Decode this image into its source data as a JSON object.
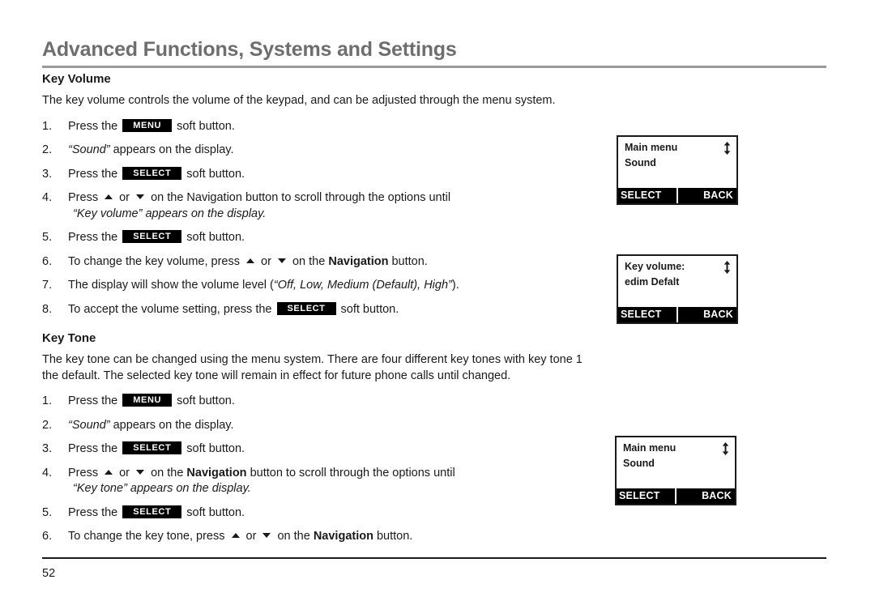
{
  "header": {
    "title": "Advanced Functions, Systems and Settings"
  },
  "sections": [
    {
      "title": "Key Volume",
      "intro": "The key volume controls the volume of the keypad, and can be adjusted through the menu system.",
      "steps": [
        {
          "num": "1.",
          "before": "Press the ",
          "chip": "MENU",
          "after": " soft button."
        },
        {
          "num": "2.",
          "quote": "“Sound”",
          "after": " appears on the display."
        },
        {
          "num": "3.",
          "before": "Press the ",
          "chip": "SELECT",
          "after": " soft button."
        },
        {
          "num": "4.",
          "before": "Press ",
          "arrows": true,
          "mid": " or ",
          "after": " on the Navigation button to scroll through the options until",
          "sub": "“Key volume” appears on the display."
        },
        {
          "num": "5.",
          "before": "Press the ",
          "chip": "SELECT",
          "after": " soft button."
        },
        {
          "num": "6.",
          "before": "To change the key volume, press ",
          "arrows": true,
          "mid": " or ",
          "after": " on the ",
          "bold": "Navigation",
          "tail": " button."
        },
        {
          "num": "7.",
          "before": "The display will show the volume level (",
          "italic": "“Off, Low, Medium (Default), High”",
          "after": ")."
        },
        {
          "num": "8.",
          "before": "To accept the volume setting, press the ",
          "chip": "SELECT",
          "after": " soft button."
        }
      ]
    },
    {
      "title": "Key Tone",
      "intro": "The key tone can be changed using the menu system. There are four different key tones with key tone 1 the default. The selected key tone will remain in effect for future phone calls until changed.",
      "steps": [
        {
          "num": "1.",
          "before": "Press the ",
          "chip": "MENU",
          "after": " soft button."
        },
        {
          "num": "2.",
          "quote": "“Sound”",
          "after": " appears on the display."
        },
        {
          "num": "3.",
          "before": "Press the ",
          "chip": "SELECT",
          "after": " soft button."
        },
        {
          "num": "4.",
          "before": "Press ",
          "arrows": true,
          "mid": " or ",
          "after": " on the ",
          "bold": "Navigation",
          "tail": " button to scroll through the options until",
          "sub": "“Key tone” appears on the display."
        },
        {
          "num": "5.",
          "before": "Press the ",
          "chip": "SELECT",
          "after": " soft button."
        },
        {
          "num": "6.",
          "before": "To change the key tone, press ",
          "arrows": true,
          "mid": " or ",
          "after": " on the ",
          "bold": "Navigation",
          "tail": " button."
        }
      ]
    }
  ],
  "displays": [
    {
      "line1": "Main menu",
      "line2": "Sound",
      "softkey_left": "SELECT",
      "softkey_right": "BACK",
      "scroll_indicator": "up-down-arrow-icon"
    },
    {
      "line1": "Key volume:",
      "line2": "edim Defalt",
      "softkey_left": "SELECT",
      "softkey_right": "BACK",
      "scroll_indicator": "up-down-arrow-icon"
    },
    {
      "line1": "Main menu",
      "line2": "Sound",
      "softkey_left": "SELECT",
      "softkey_right": "BACK",
      "scroll_indicator": "up-down-arrow-icon"
    }
  ],
  "footer": {
    "page_number": "52"
  },
  "colors": {
    "header_gray": "#6e6e6e",
    "rule_gray": "#9a9a9a",
    "text_black": "#1a1a1a",
    "chip_black": "#000000"
  }
}
